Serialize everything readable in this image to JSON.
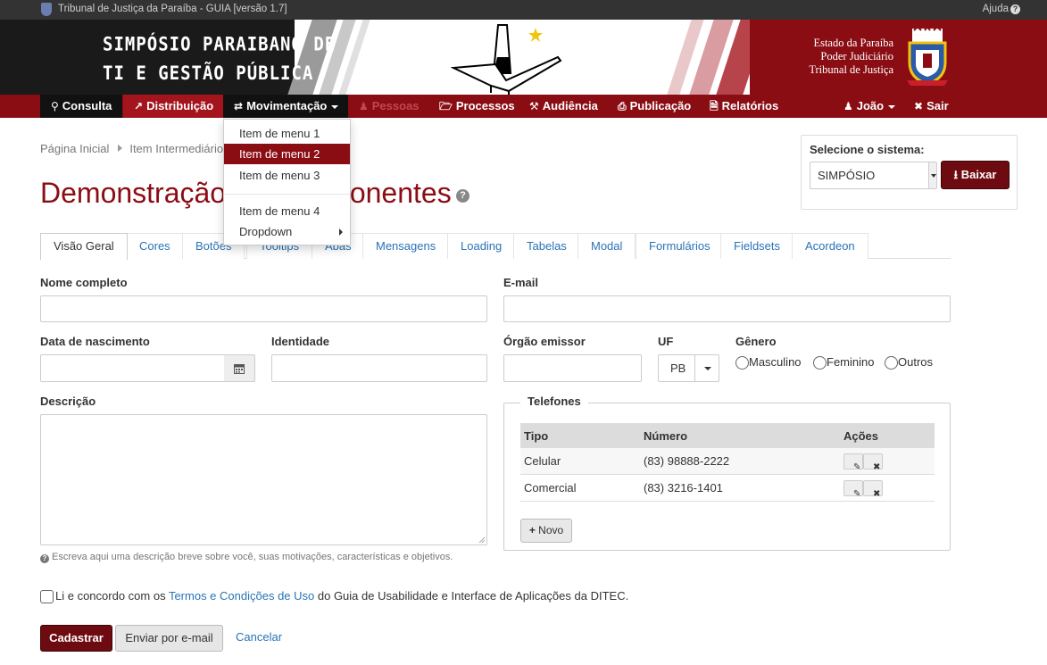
{
  "topbar": {
    "title": "Tribunal de Justiça da Paraíba - GUIA [versão 1.7]",
    "help": "Ajuda"
  },
  "banner": {
    "event_line1": "SIMPÓSIO PARAIBANO DE",
    "event_line2": "TI E GESTÃO PÚBLICA",
    "org_line1": "Estado da Paraíba",
    "org_line2": "Poder Judiciário",
    "org_line3": "Tribunal de Justiça"
  },
  "nav": {
    "items": [
      {
        "label": "Consulta",
        "icon": "search-icon"
      },
      {
        "label": "Distribuição",
        "icon": "external-link-icon"
      },
      {
        "label": "Movimentação",
        "icon": "exchange-icon"
      },
      {
        "label": "Pessoas",
        "icon": "users-icon"
      },
      {
        "label": "Processos",
        "icon": "folder-open-icon"
      },
      {
        "label": "Audiência",
        "icon": "gavel-icon"
      },
      {
        "label": "Publicação",
        "icon": "print-icon"
      },
      {
        "label": "Relatórios",
        "icon": "file-text-icon"
      }
    ],
    "user": "João",
    "logout": "Sair"
  },
  "dropdown": {
    "items": [
      "Item de menu 1",
      "Item de menu 2",
      "Item de menu 3",
      "Item de menu 4",
      "Dropdown"
    ]
  },
  "breadcrumb": {
    "home": "Página Inicial",
    "current": "Item Intermediário"
  },
  "page": {
    "title": "Demonstração de Componentes"
  },
  "system": {
    "label": "Selecione o sistema:",
    "selected": "SIMPÓSIO",
    "download": "Baixar"
  },
  "tabs": [
    "Visão Geral",
    "Cores",
    "Botões",
    "Tooltips",
    "Abas",
    "Mensagens",
    "Loading",
    "Tabelas",
    "Modal",
    "Formulários",
    "Fieldsets",
    "Acordeon"
  ],
  "form": {
    "name_label": "Nome completo",
    "email_label": "E-mail",
    "birth_label": "Data de nascimento",
    "id_label": "Identidade",
    "issuer_label": "Órgão emissor",
    "uf_label": "UF",
    "uf_value": "PB",
    "gender_label": "Gênero",
    "genders": [
      "Masculino",
      "Feminino",
      "Outros"
    ],
    "desc_label": "Descrição",
    "desc_help": "Escreva aqui uma descrição breve sobre você, suas motivações, características e objetivos."
  },
  "phones": {
    "legend": "Telefones",
    "headers": [
      "Tipo",
      "Número",
      "Ações"
    ],
    "rows": [
      {
        "type": "Celular",
        "number": "(83) 98888-2222"
      },
      {
        "type": "Comercial",
        "number": "(83) 3216-1401"
      }
    ],
    "new_button": "Novo"
  },
  "terms": {
    "before": "Li e concordo com os ",
    "link": "Termos e Condições de Uso",
    "after": " do Guia de Usabilidade e Interface de Aplicações da DITEC."
  },
  "actions": {
    "submit": "Cadastrar",
    "email": "Enviar por e-mail",
    "cancel": "Cancelar"
  },
  "colors": {
    "brand": "#8b0d14",
    "brand_dark": "#6d0b10",
    "link": "#2a73b6",
    "topbar": "#333333"
  }
}
